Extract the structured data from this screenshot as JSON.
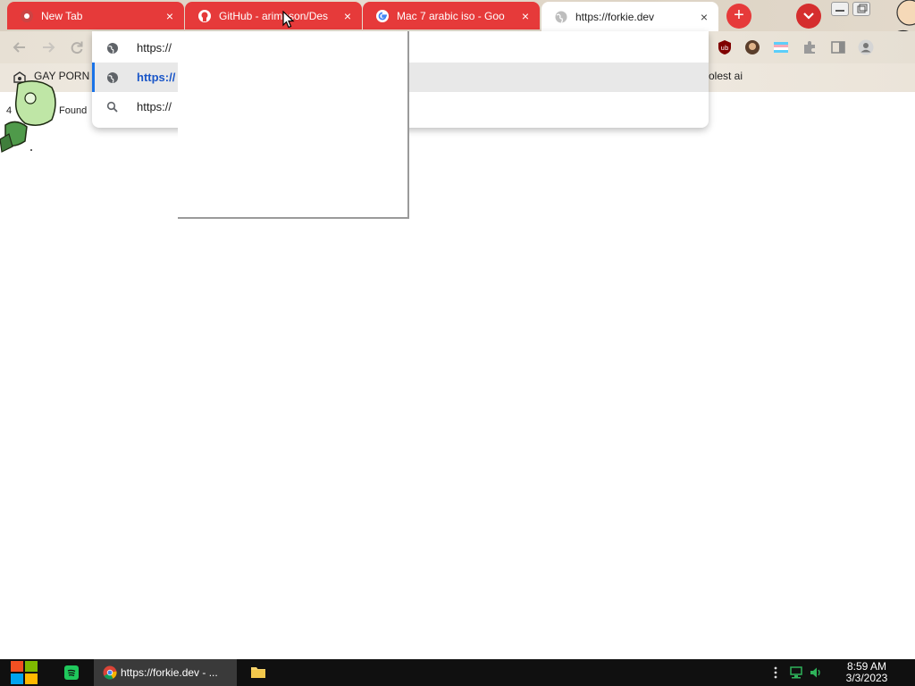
{
  "tabs": [
    {
      "title": "New Tab",
      "active": false
    },
    {
      "title": "GitHub - arimbson/Des",
      "active": false
    },
    {
      "title": "Mac 7 arabic iso - Goo",
      "active": false
    },
    {
      "title": "https://forkie.dev",
      "active": true
    }
  ],
  "tab_close_glyph": "×",
  "new_tab_glyph": "+",
  "tab_accent_color": "#e63a3a",
  "omnibox": {
    "suggestions": [
      {
        "text": "https://",
        "icon": "globe-icon"
      },
      {
        "text": "https://",
        "icon": "globe-icon",
        "selected": true
      },
      {
        "text": "https://",
        "icon": "search-icon"
      }
    ]
  },
  "bookmarks": {
    "first_label": "GAY PORN",
    "right_label": "olest ai"
  },
  "page": {
    "fragment_left": "4",
    "fragment_found": "Found"
  },
  "taskbar": {
    "chrome_label": "https://forkie.dev - ...",
    "time": "8:59 AM",
    "date": "3/3/2023"
  }
}
